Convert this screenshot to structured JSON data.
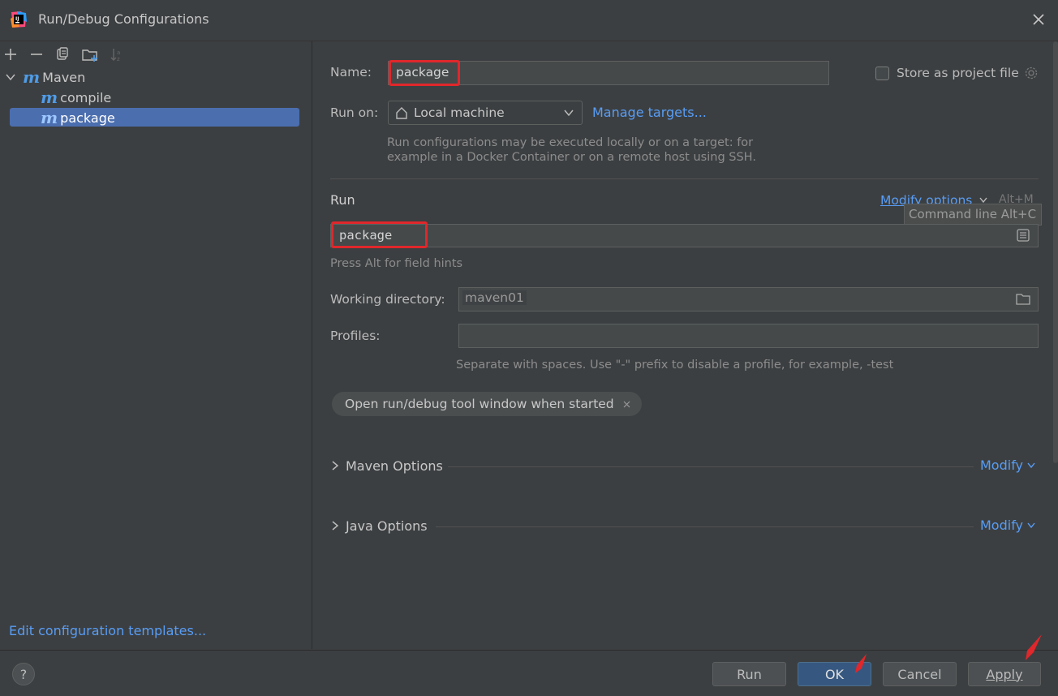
{
  "window": {
    "title": "Run/Debug Configurations"
  },
  "tree": {
    "group": "Maven",
    "group_icon": "m",
    "items": [
      {
        "icon": "m",
        "label": "compile"
      },
      {
        "icon": "m",
        "label": "package"
      }
    ]
  },
  "left": {
    "edit_templates": "Edit configuration templates..."
  },
  "form": {
    "name_label": "Name:",
    "name_value": "package",
    "store_label": "Store as project file",
    "run_on_label": "Run on:",
    "run_on_value": "Local machine",
    "manage_targets": "Manage targets...",
    "run_on_hint_1": "Run configurations may be executed locally or on a target: for",
    "run_on_hint_2": "example in a Docker Container or on a remote host using SSH.",
    "run_section": "Run",
    "modify_options": "Modify options",
    "modify_shortcut": "Alt+M",
    "tooltip": "Command line Alt+C",
    "command_value": "package",
    "field_hints": "Press Alt for field hints",
    "workdir_label": "Working directory:",
    "workdir_value": "maven01",
    "profiles_label": "Profiles:",
    "profiles_value": "",
    "profiles_hint": "Separate with spaces. Use \"-\" prefix to disable a profile, for example, -test",
    "chip": "Open run/debug tool window when started",
    "maven_options": "Maven Options",
    "java_options": "Java Options",
    "modify": "Modify"
  },
  "buttons": {
    "run": "Run",
    "ok": "OK",
    "cancel": "Cancel",
    "apply": "Apply",
    "help": "?"
  },
  "colors": {
    "accent_link": "#589df6",
    "selection": "#4b6eaf",
    "highlight": "#e0272b",
    "ok_button": "#365880"
  }
}
